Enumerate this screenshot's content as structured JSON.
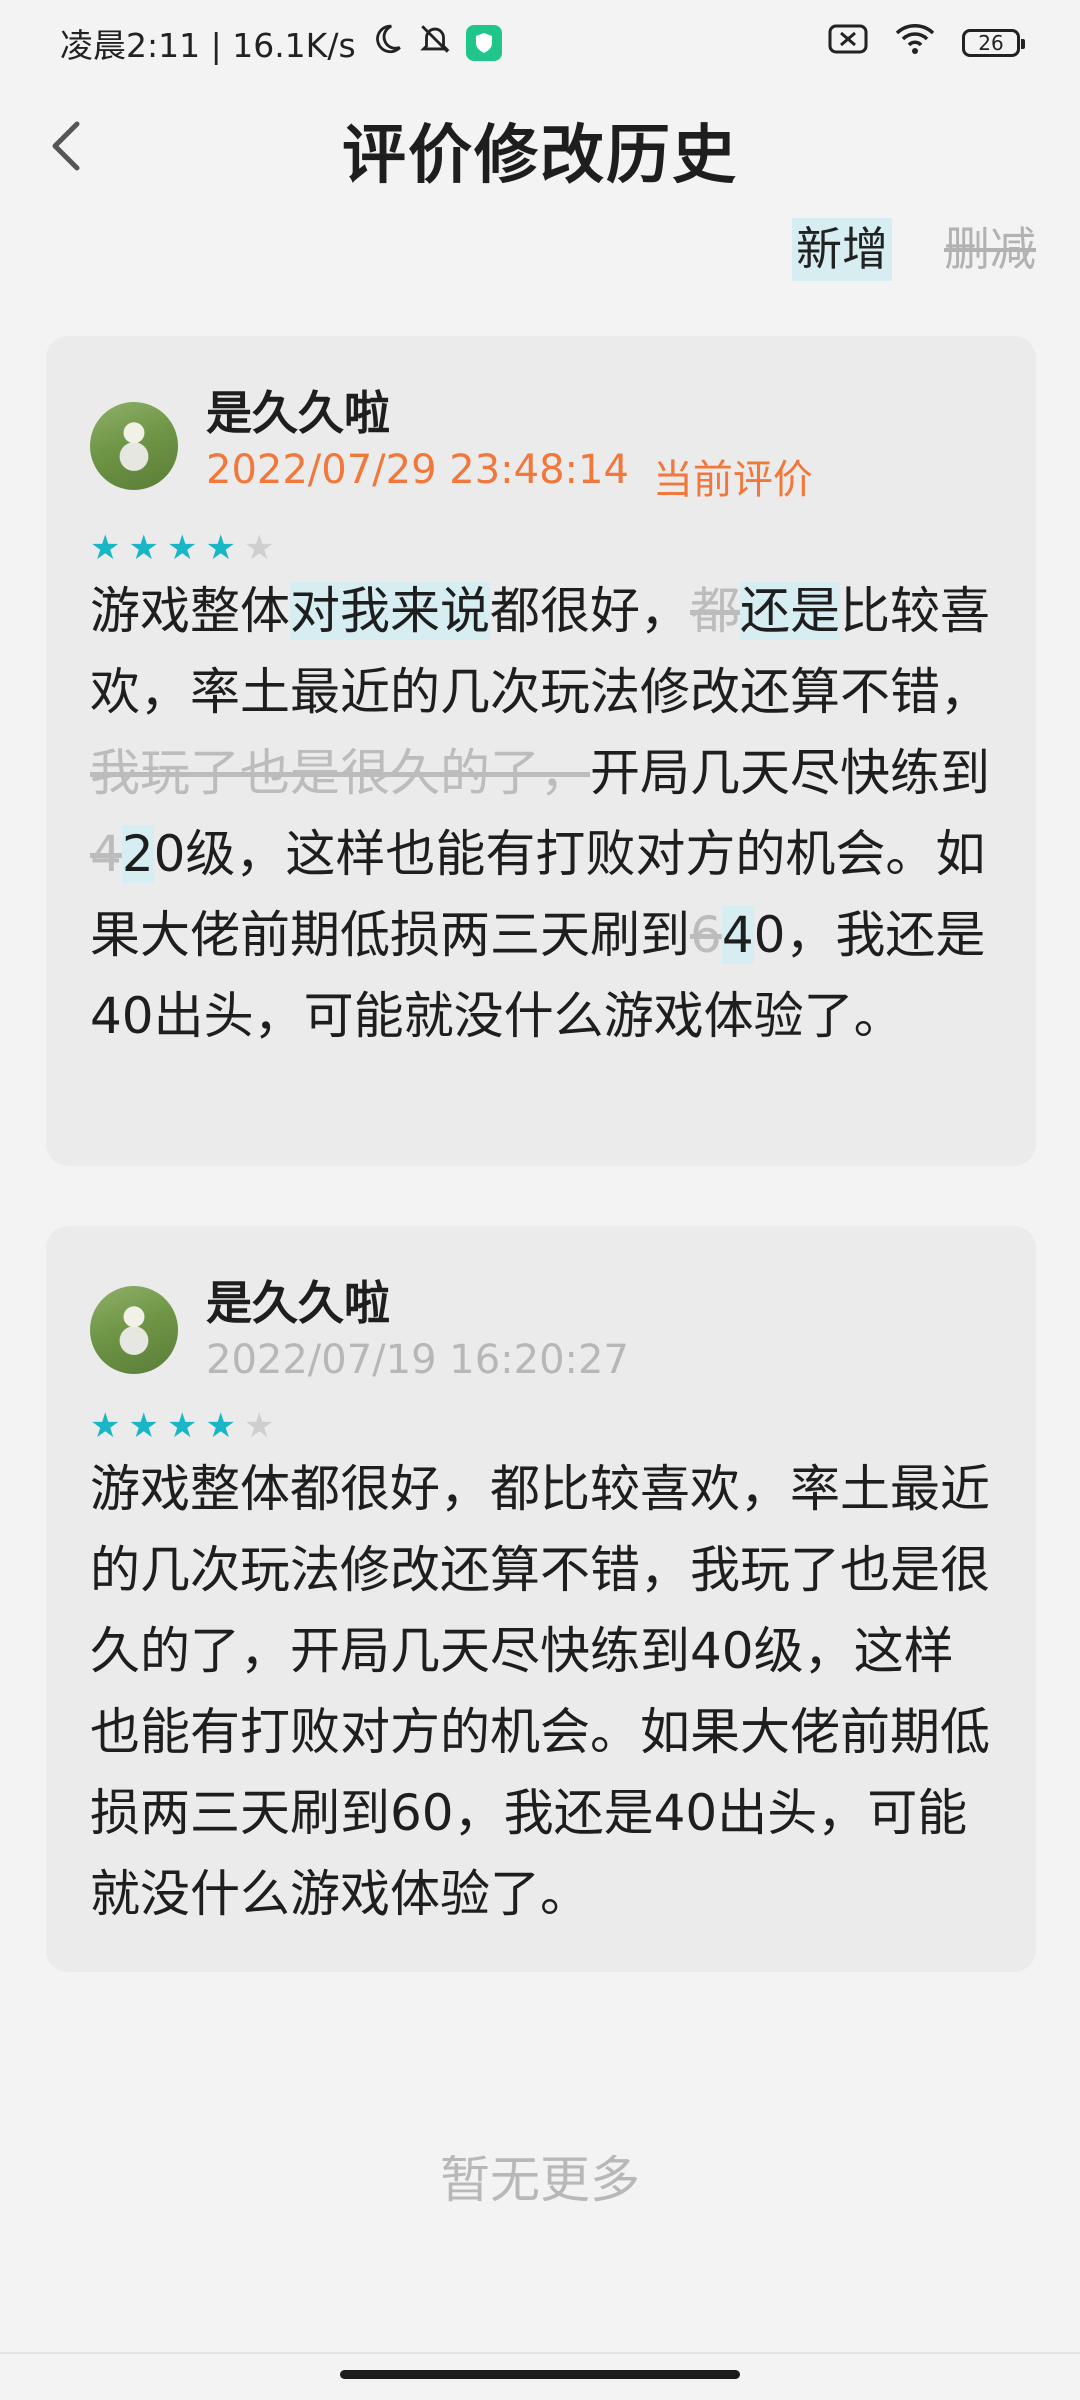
{
  "status_bar": {
    "time_speed": "凌晨2:11 | 16.1K/s",
    "battery": "26"
  },
  "header": {
    "title": "评价修改历史"
  },
  "legend": {
    "add_label": "新增",
    "delete_label": "删减"
  },
  "reviews": [
    {
      "username": "是久久啦",
      "datetime": "2022/07/29 23:48:14",
      "tag": "当前评价",
      "rating": 4,
      "rating_max": 5,
      "segments": [
        {
          "t": "游戏整体",
          "k": "n"
        },
        {
          "t": "对我来说",
          "k": "add"
        },
        {
          "t": "都很好，",
          "k": "n"
        },
        {
          "t": "都",
          "k": "del"
        },
        {
          "t": "还是",
          "k": "add"
        },
        {
          "t": "比较喜欢，率土最近的几次玩法修改还算不错，",
          "k": "n"
        },
        {
          "t": "我玩了也是很久的了，",
          "k": "del"
        },
        {
          "t": "开局几天尽快练到",
          "k": "n"
        },
        {
          "t": "4",
          "k": "del"
        },
        {
          "t": "2",
          "k": "add"
        },
        {
          "t": "0级，这样也能有打败对方的机会。如果大佬前期低损两三天刷到",
          "k": "n"
        },
        {
          "t": "6",
          "k": "del"
        },
        {
          "t": "4",
          "k": "add"
        },
        {
          "t": "0，我还是40出头，可能就没什么游戏体验了。",
          "k": "n"
        }
      ]
    },
    {
      "username": "是久久啦",
      "datetime": "2022/07/19 16:20:27",
      "tag": "",
      "rating": 4,
      "rating_max": 5,
      "segments": [
        {
          "t": "游戏整体都很好，都比较喜欢，率土最近的几次玩法修改还算不错，我玩了也是很久的了，开局几天尽快练到40级，这样也能有打败对方的机会。如果大佬前期低损两三天刷到60，我还是40出头，可能就没什么游戏体验了。",
          "k": "n"
        }
      ]
    }
  ],
  "footer": {
    "no_more": "暂无更多"
  },
  "colors": {
    "accent_star": "#19b7c6",
    "current_time": "#f1773a",
    "added_highlight": "#d6eef1",
    "deleted_text": "#bcbcbc"
  }
}
